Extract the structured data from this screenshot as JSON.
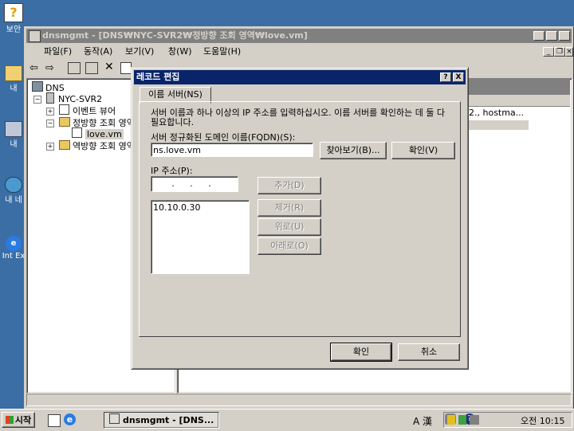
{
  "desktop": {
    "icons": [
      {
        "label": "보안",
        "name": "security-help-icon"
      },
      {
        "label": "내",
        "name": "my-documents-icon"
      },
      {
        "label": "내",
        "name": "my-computer-icon"
      },
      {
        "label": "내 네",
        "name": "my-network-icon"
      },
      {
        "label": "Int Ex",
        "name": "internet-explorer-icon"
      }
    ]
  },
  "mmc": {
    "title": "dnsmgmt - [DNS₩NYC-SVR2₩정방향 조회 영역₩love.vm]",
    "menu": [
      "파일(F)",
      "동작(A)",
      "보기(V)",
      "창(W)",
      "도움말(H)"
    ],
    "tree": {
      "root": "DNS",
      "server": "NYC-SVR2",
      "event_viewer": "이벤트 뷰어",
      "forward_zones": "정방향 조회 영역",
      "zone": "love.vm",
      "reverse_zones": "역방향 조회 영역"
    },
    "right_cell": "2., hostma..."
  },
  "dialog": {
    "title": "레코드 편집",
    "help_btn": "?",
    "close_btn": "X",
    "tab": "이름 서버(NS)",
    "description": "서버 이름과 하나 이상의 IP 주소를 입력하십시오. 이름 서버를 확인하는 데 둘 다 필요합니다.",
    "fqdn_label": "서버 정규화된 도메인 이름(FQDN)(S):",
    "fqdn_value": "ns.love.vm",
    "browse_btn": "찾아보기(B)...",
    "resolve_btn": "확인(V)",
    "ip_label": "IP 주소(P):",
    "ip_input": ". . .",
    "ip_list": [
      "10.10.0.30"
    ],
    "add_btn": "추가(D)",
    "remove_btn": "제거(R)",
    "up_btn": "위로(U)",
    "down_btn": "아래로(O)",
    "ok_btn": "확인",
    "cancel_btn": "취소"
  },
  "taskbar": {
    "start": "시작",
    "task": "dnsmgmt - [DNS...",
    "ime": "A 漢",
    "clock": "오전 10:15"
  }
}
